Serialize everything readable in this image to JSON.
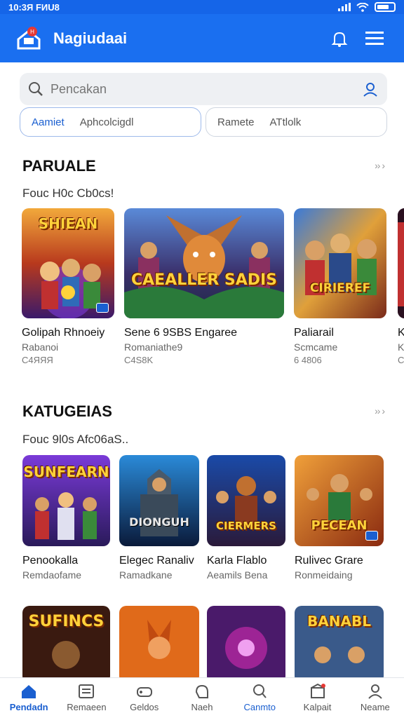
{
  "status": {
    "time": "10:3Я FИU8"
  },
  "app": {
    "title": "Nagiudaai"
  },
  "search": {
    "placeholder": "Pencakan"
  },
  "chips": [
    {
      "a": "Aamiet",
      "b": "Aphcolcigdl"
    },
    {
      "a": "Ramete",
      "b": "ATtlolk"
    }
  ],
  "sections": [
    {
      "title": "PARUALE",
      "subtitle": "Fouc H0c Cb0cs!",
      "more": "›› ›",
      "items": [
        {
          "title": "Golipah Rhnoeiy",
          "sub": "Rabanoi",
          "meta": "C4ЯЯЯ",
          "art": "SHIEAN",
          "icon": "heroes-art-icon"
        },
        {
          "title": "Sene 6 9SBS Engaree",
          "sub": "Romaniathe9",
          "meta": "C4S8K",
          "art": "CAEALLER SADIS",
          "icon": "winged-beast-art-icon"
        },
        {
          "title": "Paliarail",
          "sub": "Scmcame",
          "meta": "6 4806",
          "art": "CIRIEREF",
          "icon": "warriors-art-icon"
        },
        {
          "title": "K",
          "sub": "K",
          "meta": "C",
          "art": "",
          "icon": "partial-art-icon"
        }
      ]
    },
    {
      "title": "KATUGEIAS",
      "subtitle": "Fouc 9l0s Afc06aS..",
      "more": "›› ›",
      "items": [
        {
          "title": "Penookalla",
          "sub": "Remdaofame",
          "art": "SUNFEARN",
          "icon": "team-art-icon"
        },
        {
          "title": "Elegec Ranaliv",
          "sub": "Ramadkane",
          "art": "DIONGUH",
          "icon": "knight-art-icon"
        },
        {
          "title": "Karla Flablo",
          "sub": "Aeamils Bena",
          "art": "CIERMERS",
          "icon": "army-art-icon"
        },
        {
          "title": "Rulivec Grare",
          "sub": "Ronmeidaing",
          "art": "PECEAN",
          "icon": "ranger-art-icon"
        }
      ]
    },
    {
      "items": [
        {
          "art": "SUFINCS",
          "icon": "rogue-art-icon"
        },
        {
          "art": "",
          "icon": "fox-warrior-art-icon"
        },
        {
          "art": "",
          "icon": "magic-art-icon"
        },
        {
          "art": "BANABL",
          "icon": "battle-art-icon"
        }
      ]
    }
  ],
  "nav": [
    {
      "label": "Pendadn",
      "icon": "home-icon",
      "active": true
    },
    {
      "label": "Remaeen",
      "icon": "list-icon"
    },
    {
      "label": "Geldos",
      "icon": "gamepad-icon"
    },
    {
      "label": "Naeh",
      "icon": "hand-icon"
    },
    {
      "label": "Canmto",
      "icon": "search-icon"
    },
    {
      "label": "Kalpait",
      "icon": "store-icon"
    },
    {
      "label": "Neame",
      "icon": "profile-icon"
    }
  ],
  "colors": {
    "brand": "#1a6ff0",
    "active": "#1a5fd0"
  }
}
